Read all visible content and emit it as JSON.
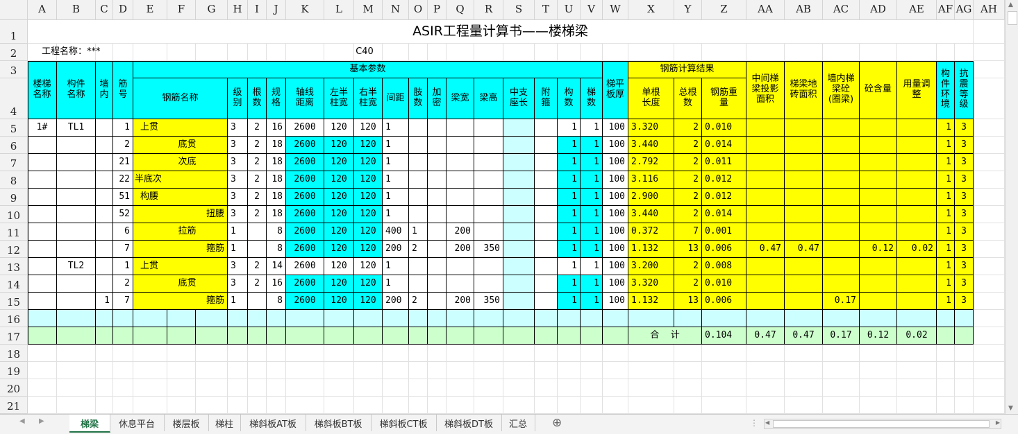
{
  "columns": [
    "A",
    "B",
    "C",
    "D",
    "E",
    "F",
    "G",
    "H",
    "I",
    "J",
    "K",
    "L",
    "M",
    "N",
    "O",
    "P",
    "Q",
    "R",
    "S",
    "T",
    "U",
    "V",
    "W",
    "X",
    "Y",
    "Z",
    "AA",
    "AB",
    "AC",
    "AD",
    "AE",
    "AF",
    "AG",
    "AH"
  ],
  "rows": [
    "1",
    "2",
    "3",
    "4",
    "5",
    "6",
    "7",
    "8",
    "9",
    "10",
    "11",
    "12",
    "13",
    "14",
    "15",
    "16",
    "17",
    "18",
    "19",
    "20",
    "21"
  ],
  "title": "ASIR工程量计算书——楼梯梁",
  "project_label": "工程名称：***",
  "concrete_grade": "C40",
  "headers": {
    "stair_name": "楼梯\n名称",
    "member_name": "构件\n名称",
    "in_wall": "墙\n内",
    "bar_no": "筋\n号",
    "basic_params": "基本参数",
    "bar_name": "钢筋名称",
    "grade": "级\n别",
    "count": "根\n数",
    "spec": "规\n格",
    "axis_dist": "轴线\n距离",
    "left_col": "左半\n柱宽",
    "right_col": "右半\n柱宽",
    "spacing": "间距",
    "legs": "肢\n数",
    "dense": "加\n密",
    "beam_width": "梁宽",
    "beam_height": "梁高",
    "mid_support": "中支\n座长",
    "extra_stirrup": "附\n箍",
    "members": "构\n数",
    "flights": "梯\n数",
    "landing_thick": "梯平\n板厚",
    "calc_result": "钢筋计算结果",
    "unit_length": "单根\n长度",
    "total_count": "总根\n数",
    "steel_weight": "钢筋重\n量",
    "mid_proj_area": "中间梯\n梁投影\n面积",
    "brick_area": "梯梁地\n砖面积",
    "wall_concrete": "墙内梯\n梁砼\n(圈梁)",
    "concrete_qty": "砼含量",
    "usage_adjust": "用量调\n整",
    "environment": "构\n件\n环\n境",
    "seismic": "抗\n震\n等\n级"
  },
  "data_rows": [
    {
      "stair": "1#",
      "member": "TL1",
      "wall": "",
      "no": "1",
      "name": "上贯",
      "name_align": "left",
      "grade": "3",
      "count": "2",
      "spec": "16",
      "axis": "2600",
      "lcol": "120",
      "rcol": "120",
      "spacing": "1",
      "legs": "",
      "dense": "",
      "bw": "",
      "bh": "",
      "mid": "",
      "extra": "",
      "members": "1",
      "flights": "1",
      "thick": "100",
      "len": "3.320",
      "total": "2",
      "weight": "0.010",
      "aa": "",
      "ab": "",
      "ac": "",
      "ad": "",
      "ae": "",
      "af": "1",
      "ag": "3",
      "cyan": false
    },
    {
      "stair": "",
      "member": "",
      "wall": "",
      "no": "2",
      "name": "底贯",
      "name_align": "center",
      "grade": "3",
      "count": "2",
      "spec": "18",
      "axis": "2600",
      "lcol": "120",
      "rcol": "120",
      "spacing": "1",
      "legs": "",
      "dense": "",
      "bw": "",
      "bh": "",
      "mid": "",
      "extra": "",
      "members": "1",
      "flights": "1",
      "thick": "100",
      "len": "3.440",
      "total": "2",
      "weight": "0.014",
      "aa": "",
      "ab": "",
      "ac": "",
      "ad": "",
      "ae": "",
      "af": "1",
      "ag": "3",
      "cyan": true
    },
    {
      "stair": "",
      "member": "",
      "wall": "",
      "no": "21",
      "name": "次底",
      "name_align": "center",
      "grade": "3",
      "count": "2",
      "spec": "18",
      "axis": "2600",
      "lcol": "120",
      "rcol": "120",
      "spacing": "1",
      "legs": "",
      "dense": "",
      "bw": "",
      "bh": "",
      "mid": "",
      "extra": "",
      "members": "1",
      "flights": "1",
      "thick": "100",
      "len": "2.792",
      "total": "2",
      "weight": "0.011",
      "aa": "",
      "ab": "",
      "ac": "",
      "ad": "",
      "ae": "",
      "af": "1",
      "ag": "3",
      "cyan": true
    },
    {
      "stair": "",
      "member": "",
      "wall": "",
      "no": "22",
      "name": "半底次",
      "name_align": "left0",
      "grade": "3",
      "count": "2",
      "spec": "18",
      "axis": "2600",
      "lcol": "120",
      "rcol": "120",
      "spacing": "1",
      "legs": "",
      "dense": "",
      "bw": "",
      "bh": "",
      "mid": "",
      "extra": "",
      "members": "1",
      "flights": "1",
      "thick": "100",
      "len": "3.116",
      "total": "2",
      "weight": "0.012",
      "aa": "",
      "ab": "",
      "ac": "",
      "ad": "",
      "ae": "",
      "af": "1",
      "ag": "3",
      "cyan": true
    },
    {
      "stair": "",
      "member": "",
      "wall": "",
      "no": "51",
      "name": "构腰",
      "name_align": "left",
      "grade": "3",
      "count": "2",
      "spec": "18",
      "axis": "2600",
      "lcol": "120",
      "rcol": "120",
      "spacing": "1",
      "legs": "",
      "dense": "",
      "bw": "",
      "bh": "",
      "mid": "",
      "extra": "",
      "members": "1",
      "flights": "1",
      "thick": "100",
      "len": "2.900",
      "total": "2",
      "weight": "0.012",
      "aa": "",
      "ab": "",
      "ac": "",
      "ad": "",
      "ae": "",
      "af": "1",
      "ag": "3",
      "cyan": true
    },
    {
      "stair": "",
      "member": "",
      "wall": "",
      "no": "52",
      "name": "扭腰",
      "name_align": "right",
      "grade": "3",
      "count": "2",
      "spec": "18",
      "axis": "2600",
      "lcol": "120",
      "rcol": "120",
      "spacing": "1",
      "legs": "",
      "dense": "",
      "bw": "",
      "bh": "",
      "mid": "",
      "extra": "",
      "members": "1",
      "flights": "1",
      "thick": "100",
      "len": "3.440",
      "total": "2",
      "weight": "0.014",
      "aa": "",
      "ab": "",
      "ac": "",
      "ad": "",
      "ae": "",
      "af": "1",
      "ag": "3",
      "cyan": true
    },
    {
      "stair": "",
      "member": "",
      "wall": "",
      "no": "6",
      "name": "拉筋",
      "name_align": "center",
      "grade": "1",
      "count": "",
      "spec": "8",
      "axis": "2600",
      "lcol": "120",
      "rcol": "120",
      "spacing": "400",
      "legs": "1",
      "dense": "",
      "bw": "200",
      "bh": "",
      "mid": "",
      "extra": "",
      "members": "1",
      "flights": "1",
      "thick": "100",
      "len": "0.372",
      "total": "7",
      "weight": "0.001",
      "aa": "",
      "ab": "",
      "ac": "",
      "ad": "",
      "ae": "",
      "af": "1",
      "ag": "3",
      "cyan": true
    },
    {
      "stair": "",
      "member": "",
      "wall": "",
      "no": "7",
      "name": "箍筋",
      "name_align": "right",
      "grade": "1",
      "count": "",
      "spec": "8",
      "axis": "2600",
      "lcol": "120",
      "rcol": "120",
      "spacing": "200",
      "legs": "2",
      "dense": "",
      "bw": "200",
      "bh": "350",
      "mid": "",
      "extra": "",
      "members": "1",
      "flights": "1",
      "thick": "100",
      "len": "1.132",
      "total": "13",
      "weight": "0.006",
      "aa": "0.47",
      "ab": "0.47",
      "ac": "",
      "ad": "0.12",
      "ae": "0.02",
      "af": "1",
      "ag": "3",
      "cyan": true
    },
    {
      "stair": "",
      "member": "TL2",
      "wall": "",
      "no": "1",
      "name": "上贯",
      "name_align": "left",
      "grade": "3",
      "count": "2",
      "spec": "14",
      "axis": "2600",
      "lcol": "120",
      "rcol": "120",
      "spacing": "1",
      "legs": "",
      "dense": "",
      "bw": "",
      "bh": "",
      "mid": "",
      "extra": "",
      "members": "1",
      "flights": "1",
      "thick": "100",
      "len": "3.200",
      "total": "2",
      "weight": "0.008",
      "aa": "",
      "ab": "",
      "ac": "",
      "ad": "",
      "ae": "",
      "af": "1",
      "ag": "3",
      "cyan": false
    },
    {
      "stair": "",
      "member": "",
      "wall": "",
      "no": "2",
      "name": "底贯",
      "name_align": "center",
      "grade": "3",
      "count": "2",
      "spec": "16",
      "axis": "2600",
      "lcol": "120",
      "rcol": "120",
      "spacing": "1",
      "legs": "",
      "dense": "",
      "bw": "",
      "bh": "",
      "mid": "",
      "extra": "",
      "members": "1",
      "flights": "1",
      "thick": "100",
      "len": "3.320",
      "total": "2",
      "weight": "0.010",
      "aa": "",
      "ab": "",
      "ac": "",
      "ad": "",
      "ae": "",
      "af": "1",
      "ag": "3",
      "cyan": true
    },
    {
      "stair": "",
      "member": "",
      "wall": "1",
      "no": "7",
      "name": "箍筋",
      "name_align": "right",
      "grade": "1",
      "count": "",
      "spec": "8",
      "axis": "2600",
      "lcol": "120",
      "rcol": "120",
      "spacing": "200",
      "legs": "2",
      "dense": "",
      "bw": "200",
      "bh": "350",
      "mid": "",
      "extra": "",
      "members": "1",
      "flights": "1",
      "thick": "100",
      "len": "1.132",
      "total": "13",
      "weight": "0.006",
      "aa": "",
      "ab": "",
      "ac": "0.17",
      "ad": "",
      "ae": "",
      "af": "1",
      "ag": "3",
      "cyan": true
    }
  ],
  "totals": {
    "label": "合    计",
    "weight": "0.104",
    "aa": "0.47",
    "ab": "0.47",
    "ac": "0.17",
    "ad": "0.12",
    "ae": "0.02"
  },
  "sheet_tabs": [
    "梯梁",
    "休息平台",
    "楼层板",
    "梯柱",
    "梯斜板AT板",
    "梯斜板BT板",
    "梯斜板CT板",
    "梯斜板DT板",
    "汇总"
  ],
  "active_tab": "梯梁",
  "add_sheet_icon": "plus-circle-icon",
  "colors": {
    "cyan": "#00ffff",
    "yellow": "#ffff00",
    "light_cyan": "#ccffff",
    "light_green": "#ccffcc",
    "tab_accent": "#217346"
  }
}
